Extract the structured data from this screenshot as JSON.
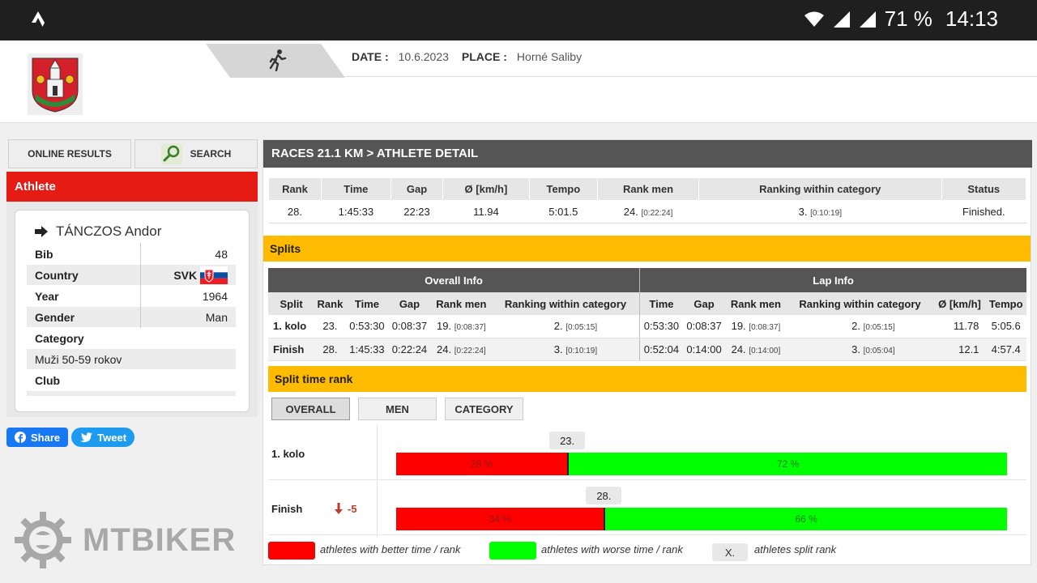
{
  "statusbar": {
    "battery": "71 %",
    "time": "14:13"
  },
  "header": {
    "date_label": "DATE :",
    "date_value": "10.6.2023",
    "place_label": "PLACE :",
    "place_value": "Horné Saliby"
  },
  "sidebar": {
    "online_results": "ONLINE RESULTS",
    "search": "SEARCH",
    "athlete_title": "Athlete",
    "athlete_name": "TÁNCZOS Andor",
    "bib_label": "Bib",
    "bib_value": "48",
    "country_label": "Country",
    "country_value": "SVK",
    "year_label": "Year",
    "year_value": "1964",
    "gender_label": "Gender",
    "gender_value": "Man",
    "category_label": "Category",
    "category_value": "Muži 50-59 rokov",
    "club_label": "Club",
    "share": "Share",
    "tweet": "Tweet"
  },
  "brand": {
    "name": "MTBIKER"
  },
  "main": {
    "title": "RACES 21.1 KM > ATHLETE DETAIL",
    "result_headers": [
      "Rank",
      "Time",
      "Gap",
      "Ø [km/h]",
      "Tempo",
      "Rank men",
      "Ranking within category",
      "Status"
    ],
    "result": {
      "rank": "28.",
      "time": "1:45:33",
      "gap": "22:23",
      "speed": "11.94",
      "tempo": "5:01.5",
      "rank_men": "24.",
      "rank_men_gap": "[0:22:24]",
      "cat_rank": "3.",
      "cat_gap": "[0:10:19]",
      "status": "Finished."
    },
    "splits_title": "Splits",
    "overall_info": "Overall Info",
    "lap_info": "Lap Info",
    "split_headers": [
      "Split",
      "Rank",
      "Time",
      "Gap",
      "Rank men",
      "Ranking within category",
      "Time",
      "Gap",
      "Rank men",
      "Ranking within category",
      "Ø [km/h]",
      "Tempo"
    ],
    "splits": [
      {
        "name": "1. kolo",
        "rank": "23.",
        "time": "0:53:30",
        "gap": "0:08:37",
        "rank_men": "19.",
        "rank_men_gap": "[0:08:37]",
        "cat": "2.",
        "cat_gap": "[0:05:15]",
        "lap_time": "0:53:30",
        "lap_gap": "0:08:37",
        "lap_rank_men": "19.",
        "lap_rank_men_gap": "[0:08:37]",
        "lap_cat": "2.",
        "lap_cat_gap": "[0:05:15]",
        "lap_speed": "11.78",
        "lap_tempo": "5:05.6"
      },
      {
        "name": "Finish",
        "rank": "28.",
        "time": "1:45:33",
        "gap": "0:22:24",
        "rank_men": "24.",
        "rank_men_gap": "[0:22:24]",
        "cat": "3.",
        "cat_gap": "[0:10:19]",
        "lap_time": "0:52:04",
        "lap_gap": "0:14:00",
        "lap_rank_men": "24.",
        "lap_rank_men_gap": "[0:14:00]",
        "lap_cat": "3.",
        "lap_cat_gap": "[0:05:04]",
        "lap_speed": "12.1",
        "lap_tempo": "4:57.4"
      }
    ],
    "split_rank_title": "Split time rank",
    "rank_tabs": [
      "OVERALL",
      "MEN",
      "CATEGORY"
    ],
    "rank_rows": [
      {
        "name": "1. kolo",
        "delta": "",
        "badge": "23.",
        "better_pct": 28,
        "better_label": "28 %",
        "worse_label": "72 %"
      },
      {
        "name": "Finish",
        "delta": "-5",
        "badge": "28.",
        "better_pct": 34,
        "better_label": "34 %",
        "worse_label": "66 %"
      }
    ],
    "legend": {
      "better": "athletes with better time / rank",
      "worse": "athletes with worse time / rank",
      "x": "X.",
      "split": "athletes split rank"
    }
  },
  "colors": {
    "red": "#ff0000",
    "green": "#00ff00",
    "yellow": "#ffbb00",
    "athlete_red": "#e51b14"
  }
}
